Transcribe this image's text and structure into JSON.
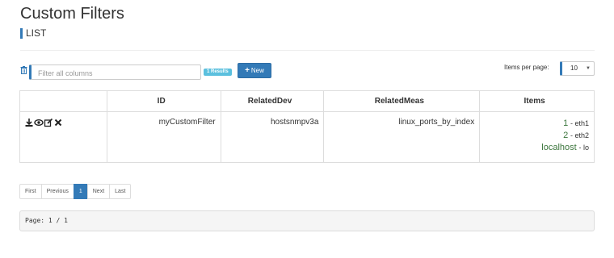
{
  "page": {
    "title": "Custom Filters",
    "subtitle": "LIST"
  },
  "toolbar": {
    "filter_placeholder": "Filter all columns",
    "results_badge": "1 Results",
    "new_label": "New",
    "items_per_page_label": "Items per page:",
    "items_per_page_value": "10"
  },
  "icons": {
    "trash": "trash-icon",
    "plus": "plus-icon",
    "caret": "caret-down-icon",
    "download": "download-icon",
    "view": "eye-icon",
    "edit": "edit-icon",
    "delete": "close-icon"
  },
  "table": {
    "headers": [
      "",
      "ID",
      "RelatedDev",
      "RelatedMeas",
      "Items"
    ],
    "rows": [
      {
        "id": "myCustomFilter",
        "related_dev": "hostsnmpv3a",
        "related_meas": "linux_ports_by_index",
        "items": [
          {
            "key": "1",
            "value": "- eth1"
          },
          {
            "key": "2",
            "value": "- eth2"
          },
          {
            "key": "localhost",
            "value": "- lo"
          }
        ]
      }
    ]
  },
  "pagination": {
    "first": "First",
    "previous": "Previous",
    "current": "1",
    "next": "Next",
    "last": "Last"
  },
  "footer": {
    "page_info": "Page: 1 / 1"
  },
  "colors": {
    "accent": "#337ab7",
    "badge": "#5bc0de",
    "item_key": "#3c763d"
  }
}
